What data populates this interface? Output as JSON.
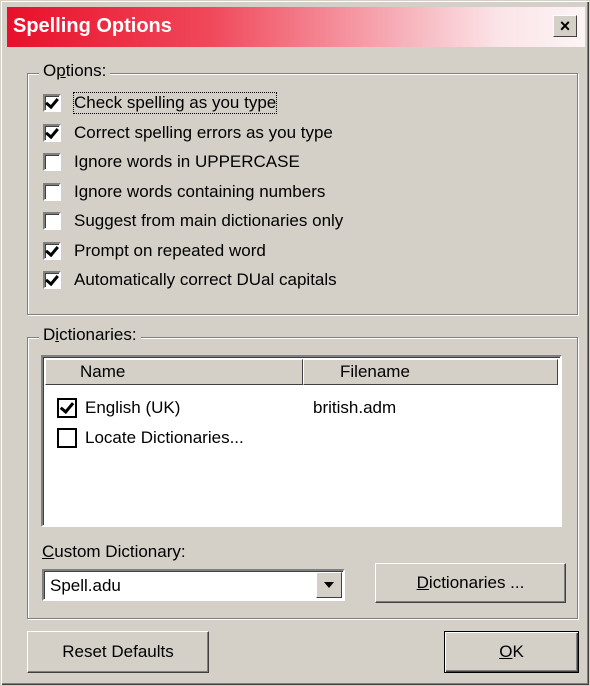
{
  "window": {
    "title": "Spelling Options",
    "close_glyph": "×"
  },
  "options": {
    "legend": "Options:",
    "items": [
      {
        "label": "Check spelling as you type",
        "checked": true
      },
      {
        "label": "Correct spelling errors as you type",
        "checked": true
      },
      {
        "label": "Ignore words in UPPERCASE",
        "checked": false
      },
      {
        "label": "Ignore words containing numbers",
        "checked": false
      },
      {
        "label": "Suggest from main dictionaries only",
        "checked": false
      },
      {
        "label": "Prompt on repeated word",
        "checked": true
      },
      {
        "label": "Automatically correct DUal capitals",
        "checked": true
      }
    ]
  },
  "dictionaries": {
    "legend": "Dictionaries:",
    "columns": [
      "Name",
      "Filename"
    ],
    "rows": [
      {
        "name": "English (UK)",
        "filename": "british.adm",
        "checked": true
      },
      {
        "name": "Locate Dictionaries...",
        "filename": "",
        "checked": false
      }
    ]
  },
  "custom_dictionary": {
    "label": "Custom Dictionary:",
    "value": "Spell.adu",
    "button_label": "Dictionaries ..."
  },
  "buttons": {
    "reset": "Reset Defaults",
    "ok": "OK"
  }
}
